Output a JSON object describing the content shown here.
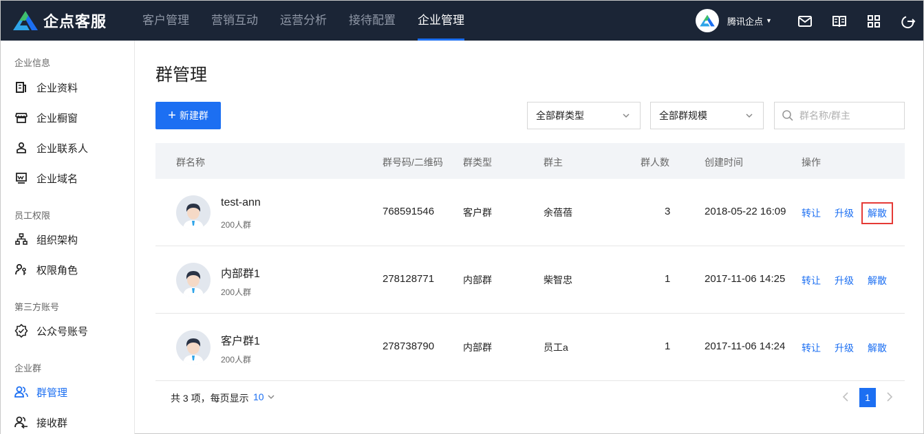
{
  "app": {
    "name": "企点客服",
    "colors": {
      "topbar": "#1b2536",
      "accent": "#1c6ff2",
      "highlight": "#e53935"
    }
  },
  "nav": {
    "items": [
      "客户管理",
      "营销互动",
      "运营分析",
      "接待配置",
      "企业管理"
    ],
    "active": "企业管理"
  },
  "account": {
    "name": "腾讯企点"
  },
  "top_icons": [
    "mail-icon",
    "book-icon",
    "grid-icon",
    "logout-icon"
  ],
  "sidebar": {
    "groups": [
      {
        "title": "企业信息",
        "items": [
          {
            "label": "企业资料",
            "icon": "document-icon"
          },
          {
            "label": "企业橱窗",
            "icon": "store-icon"
          },
          {
            "label": "企业联系人",
            "icon": "contact-icon"
          },
          {
            "label": "企业域名",
            "icon": "domain-icon"
          }
        ]
      },
      {
        "title": "员工权限",
        "items": [
          {
            "label": "组织架构",
            "icon": "org-chart-icon"
          },
          {
            "label": "权限角色",
            "icon": "role-key-icon"
          }
        ]
      },
      {
        "title": "第三方账号",
        "items": [
          {
            "label": "公众号账号",
            "icon": "verified-badge-icon"
          }
        ]
      },
      {
        "title": "企业群",
        "items": [
          {
            "label": "群管理",
            "icon": "group-users-icon",
            "active": true
          },
          {
            "label": "接收群",
            "icon": "group-receive-icon"
          }
        ]
      }
    ]
  },
  "main": {
    "title": "群管理",
    "new_button": "新建群",
    "filters": {
      "type": "全部群类型",
      "scale": "全部群规模",
      "search_placeholder": "群名称/群主"
    },
    "columns": [
      "群名称",
      "群号码/二维码",
      "群类型",
      "群主",
      "群人数",
      "创建时间",
      "操作"
    ],
    "rows": [
      {
        "name": "test-ann",
        "size": "200人群",
        "number": "768591546",
        "type": "客户群",
        "owner": "余蓓蓓",
        "members": "3",
        "created": "2018-05-22 16:09",
        "ops": [
          "转让",
          "升级",
          "解散"
        ]
      },
      {
        "name": "内部群1",
        "size": "200人群",
        "number": "278128771",
        "type": "内部群",
        "owner": "柴智忠",
        "members": "1",
        "created": "2017-11-06 14:25",
        "ops": [
          "转让",
          "升级",
          "解散"
        ]
      },
      {
        "name": "客户群1",
        "size": "200人群",
        "number": "278738790",
        "type": "内部群",
        "owner": "员工a",
        "members": "1",
        "created": "2017-11-06 14:24",
        "ops": [
          "转让",
          "升级",
          "解散"
        ]
      }
    ],
    "footer": {
      "total": "共 3 项，每页显示",
      "page_size": "10",
      "current_page": "1"
    }
  }
}
